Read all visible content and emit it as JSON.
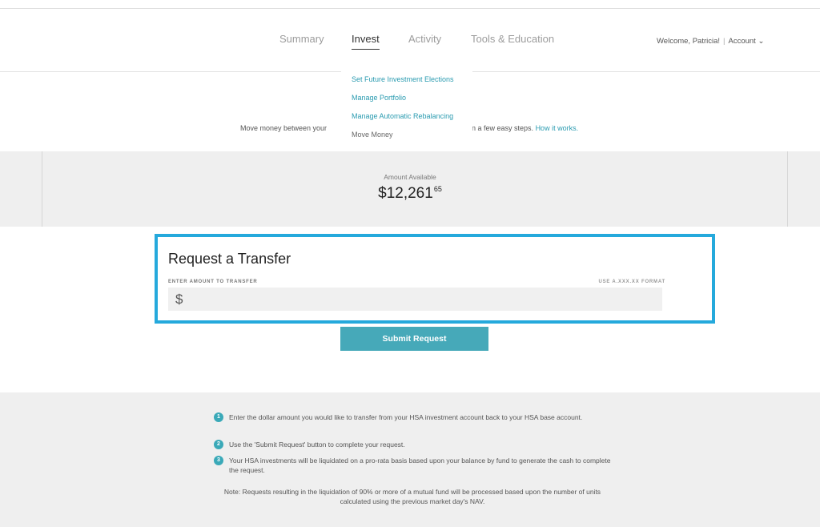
{
  "nav": {
    "items": [
      "Summary",
      "Invest",
      "Activity",
      "Tools & Education"
    ],
    "active": "Invest"
  },
  "user": {
    "welcome": "Welcome, Patricia!",
    "account_label": "Account",
    "account_chevron": "chevron-down-icon"
  },
  "invest_menu": {
    "items": [
      "Set Future Investment Elections",
      "Manage Portfolio",
      "Manage Automatic Rebalancing",
      "Move Money"
    ]
  },
  "intro": {
    "left_text": "Move money between your",
    "right_text": "n a few easy steps.",
    "link": "How it works."
  },
  "balance": {
    "label": "Amount Available",
    "whole": "$12,261",
    "cents": "65"
  },
  "transfer": {
    "title": "Request a Transfer",
    "field_label": "ENTER AMOUNT TO TRANSFER",
    "field_hint": "USE A.XXX.XX FORMAT",
    "currency_symbol": "$",
    "value": "",
    "submit_label": "Submit Request"
  },
  "instructions": {
    "steps": [
      {
        "num": "1",
        "text": "Enter the dollar amount you would like to transfer from your HSA investment account back to your HSA base account."
      },
      {
        "num": "2",
        "text": "Use the 'Submit Request' button to complete your request."
      },
      {
        "num": "3",
        "text": "Your HSA investments will be liquidated on a pro-rata basis based upon your balance by fund to generate the cash to complete the request."
      }
    ],
    "note": "Note: Requests resulting in the liquidation of 90% or more of a mutual fund will be processed based upon the number of units calculated using the previous market day's NAV."
  },
  "colors": {
    "accent": "#2a9bb0",
    "highlight_border": "#25a9dc",
    "button": "#46a9b9",
    "band": "#efefef"
  }
}
